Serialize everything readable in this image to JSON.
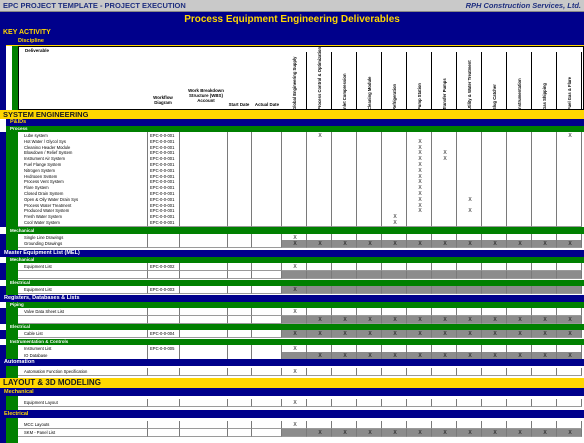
{
  "header": {
    "left_title": "EPC PROJECT TEMPLATE - PROJECT EXECUTION",
    "company": "RPH Construction Services, Ltd.",
    "main_title": "Process Equipment Engineering Deliverables"
  },
  "sections": {
    "key_activity": "KEY ACTIVITY",
    "discipline": "Discipline",
    "deliverable": "Deliverable",
    "system_engineering": "SYSTEM ENGINEERING",
    "pids": "P&IDs",
    "process": "Process",
    "mechanical": "Mechanical",
    "electrical": "Electrical",
    "mel": "Master Equipment List (MEL)",
    "mel_mech": "Mechanical",
    "mel_elec": "Electrical",
    "registers": "Registers, Databases & Lists",
    "piping": "Piping",
    "reg_elec": "Electrical",
    "instrumentation": "Instrumentation & Controls",
    "automation": "Automation",
    "layout": "LAYOUT & 3D MODELING",
    "lay_mech": "Mechanical",
    "lay_elec": "Electrical"
  },
  "columns": {
    "workflow": "Workflow Diagram",
    "wbs": "Work Breakdown Structure (WBS) Account",
    "start": "Start Date",
    "actual": "Actual Date",
    "vertical": [
      "Global Engineering Supply",
      "Process Control & Optimization",
      "Inlet Compression",
      "Cleaning Module",
      "Refrigeration",
      "Pump Station",
      "Transfer Pumps",
      "Utility & Water Treatment",
      "Slug Catcher",
      "Instrumentation",
      "Gas Shipping",
      "Fuel Gas & Flare"
    ]
  },
  "rows": {
    "process": [
      "Lube system",
      "Hot Water / Glycol Sys",
      "Cleaning Header Module",
      "Blowdown / Relief System",
      "Instrument Air System",
      "Fuel Flange System",
      "Nitrogen System",
      "Hydrogen System",
      "Process Vent System",
      "Flare System",
      "Closed Drain System",
      "Open & Oily Water Drain Sys",
      "Process Water Treatment",
      "Produced Water System",
      "Fresh Water System",
      "Cool Water System"
    ],
    "process_wbs": "EPC-0-0-001",
    "process_marks": [
      [
        1,
        11
      ],
      [
        5
      ],
      [
        5
      ],
      [
        5,
        6
      ],
      [
        5,
        6
      ],
      [
        5
      ],
      [
        5
      ],
      [
        5
      ],
      [
        5
      ],
      [
        5
      ],
      [
        5
      ],
      [
        5,
        7
      ],
      [
        5
      ],
      [
        5,
        7
      ],
      [
        4
      ],
      [
        4
      ]
    ],
    "mechanical": [
      "Single Line Drawings",
      "Grounding Drawings"
    ],
    "mel_mech": [
      "Equipment List"
    ],
    "mel_mech_wbs": "EPC-0-0-002",
    "mel_elec": [
      "Equipment List"
    ],
    "mel_elec_wbs": "EPC-0-0-003",
    "piping": [
      "Valve Data Sheet List"
    ],
    "reg_elec": [
      "Cable List"
    ],
    "reg_elec_wbs": "EPC-0-0-004",
    "instrumentation": [
      "Instrument List",
      "IO Database"
    ],
    "instrumentation_wbs": "EPC-0-0-005",
    "automation": [
      "Automation Function Specification"
    ],
    "lay_mech": [
      "Equipment Layout"
    ],
    "lay_elec": [
      "MCC Layouts",
      "SKM - Panel List"
    ],
    "x_mark": "X"
  },
  "colors": {
    "navy": "#00008b",
    "green": "#008000",
    "gold": "#ffd700",
    "cell_gray": "#8c8c8c"
  }
}
